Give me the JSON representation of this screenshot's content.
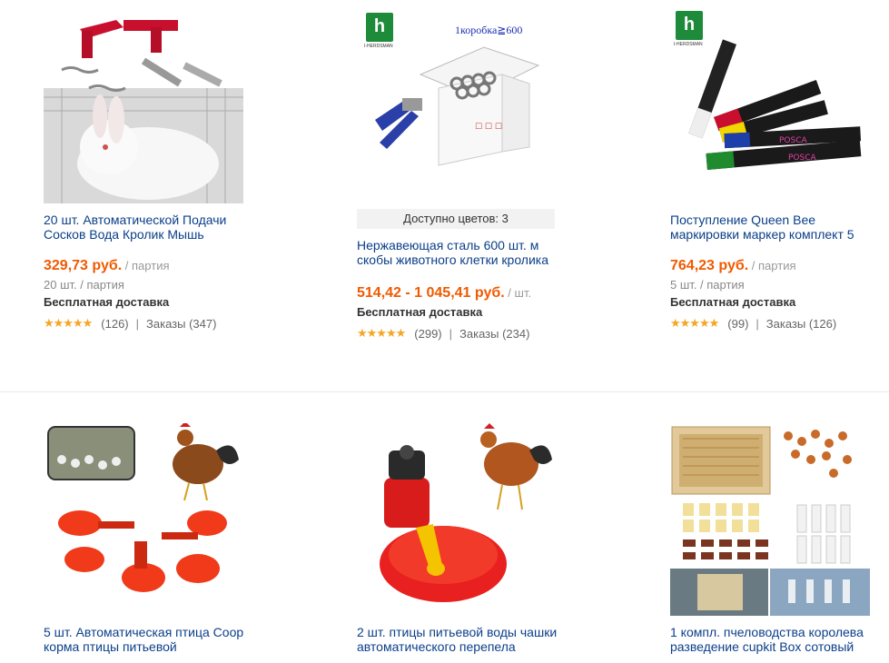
{
  "products": [
    {
      "title": "20 шт. Автоматической Подачи Сосков Вода Кролик Мышь",
      "price": "329,73 руб.",
      "price_unit": "/ партия",
      "lot": "20 шт. / партия",
      "shipping": "Бесплатная доставка",
      "stars": "★★★★★",
      "reviews": "(126)",
      "orders": "Заказы (347)"
    },
    {
      "colors": "Доступно цветов: 3",
      "title": "Нержавеющая сталь 600 шт. м скобы животного клетки кролика",
      "price": "514,42 - 1 045,41 руб.",
      "price_unit": "/ шт.",
      "shipping": "Бесплатная доставка",
      "stars": "★★★★★",
      "reviews": "(299)",
      "orders": "Заказы (234)",
      "box_label": "1коробка≧600",
      "brand": "I-HERDSMAN"
    },
    {
      "title": "Поступление Queen Bee маркировки маркер комплект 5",
      "price": "764,23 руб.",
      "price_unit": "/ партия",
      "lot": "5 шт. / партия",
      "shipping": "Бесплатная доставка",
      "stars": "★★★★★",
      "reviews": "(99)",
      "orders": "Заказы (126)",
      "brand": "I-HERDSMAN"
    },
    {
      "title": "5 шт. Автоматическая птица Coop корма птицы питьевой"
    },
    {
      "title": "2 шт. птицы питьевой воды чашки автоматического перепела"
    },
    {
      "title": "1 компл. пчеловодства королева разведение cupkit Box сотовый"
    }
  ],
  "colors": {
    "price": "#f05a00",
    "title_link": "#0b3f8a",
    "star": "#f5a623"
  }
}
